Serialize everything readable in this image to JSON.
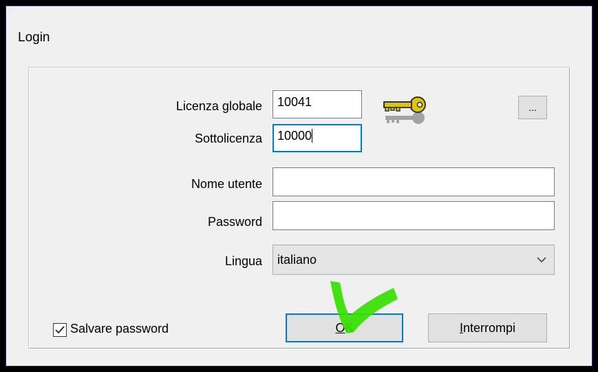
{
  "dialog": {
    "title": "Login"
  },
  "license": {
    "global_label": "Licenza globale",
    "global_value": "10041",
    "sub_label": "Sottolicenza",
    "sub_value": "10000",
    "browse_label": "..."
  },
  "credentials": {
    "username_label": "Nome utente",
    "username_value": "",
    "password_label": "Password",
    "password_value": ""
  },
  "language": {
    "label": "Lingua",
    "selected": "italiano"
  },
  "save_password": {
    "label": "Salvare password",
    "checked": true
  },
  "buttons": {
    "ok_accel": "O",
    "ok_rest": "K",
    "cancel_accel": "I",
    "cancel_rest": "nterrompi"
  },
  "colors": {
    "focus_border": "#0078d7",
    "annotation_mark": "#35e000",
    "key_gold": "#e3c400"
  },
  "icons": {
    "keys": "keys-icon",
    "dropdown": "chevron-down-icon",
    "checkbox": "checkmark-icon"
  }
}
